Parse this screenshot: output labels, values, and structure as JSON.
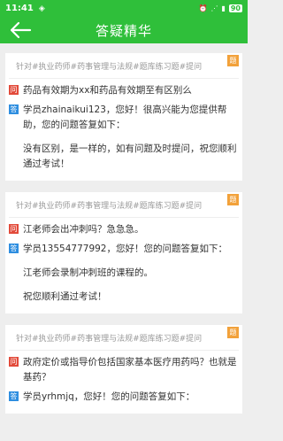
{
  "status": {
    "time": "11:41",
    "battery": "90"
  },
  "header": {
    "title": "答疑精华"
  },
  "items": [
    {
      "tag": "针对#执业药师#药事管理与法规#题库练习题#提问",
      "corner": "题",
      "question": "药品有效期为xx和药品有效期至有区别么",
      "answer": "学员zhainaikui123，您好！很高兴能为您提供帮助，您的问题答复如下：",
      "answer_body": "没有区别，是一样的，如有问题及时提问，祝您顺利通过考试！",
      "answer_body2": ""
    },
    {
      "tag": "针对#执业药师#药事管理与法规#题库练习题#提问",
      "corner": "题",
      "question": "江老师会出冲刺吗？急急急。",
      "answer": "学员13554777992，您好！您的问题答复如下：",
      "answer_body": "江老师会录制冲刺班的课程的。",
      "answer_body2": "祝您顺利通过考试！"
    },
    {
      "tag": "针对#执业药师#药事管理与法规#题库练习题#提问",
      "corner": "题",
      "question": "政府定价或指导价包括国家基本医疗用药吗？也就是基药？",
      "answer": "学员yrhmjq，您好！您的问题答复如下：",
      "answer_body": "",
      "answer_body2": ""
    }
  ]
}
